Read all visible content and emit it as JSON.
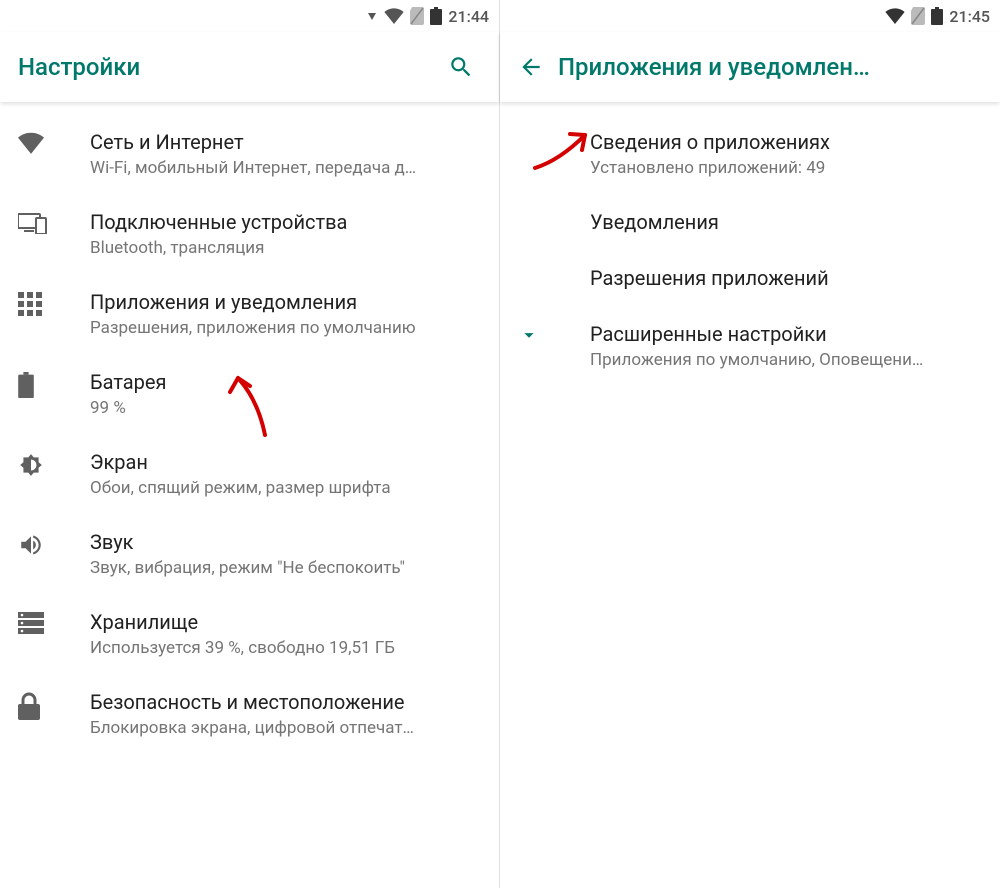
{
  "left": {
    "status_time": "21:44",
    "appbar_title": "Настройки",
    "items": [
      {
        "title": "Сеть и Интернет",
        "subtitle": "Wi-Fi, мобильный Интернет, передача д…"
      },
      {
        "title": "Подключенные устройства",
        "subtitle": "Bluetooth, трансляция"
      },
      {
        "title": "Приложения и уведомления",
        "subtitle": "Разрешения, приложения по умолчанию"
      },
      {
        "title": "Батарея",
        "subtitle": "99 %"
      },
      {
        "title": "Экран",
        "subtitle": "Обои, спящий режим, размер шрифта"
      },
      {
        "title": "Звук",
        "subtitle": "Звук, вибрация, режим \"Не беспокоить\""
      },
      {
        "title": "Хранилище",
        "subtitle": "Используется 39 %, свободно 19,51 ГБ"
      },
      {
        "title": "Безопасность и местоположение",
        "subtitle": "Блокировка экрана, цифровой отпечат…"
      }
    ]
  },
  "right": {
    "status_time": "21:45",
    "appbar_title": "Приложения и уведомлен…",
    "items": [
      {
        "title": "Сведения о приложениях",
        "subtitle": "Установлено приложений: 49"
      },
      {
        "title": "Уведомления",
        "subtitle": ""
      },
      {
        "title": "Разрешения приложений",
        "subtitle": ""
      },
      {
        "title": "Расширенные настройки",
        "subtitle": "Приложения по умолчанию, Оповещени…"
      }
    ]
  }
}
